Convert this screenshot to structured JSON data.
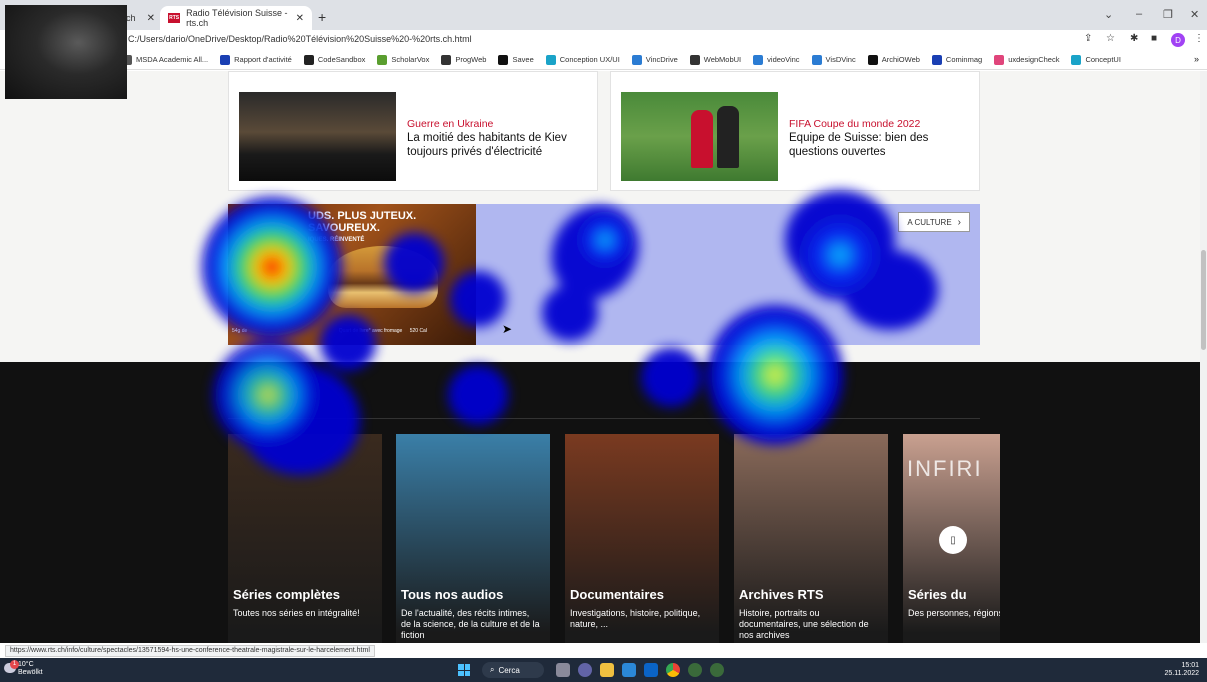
{
  "browser": {
    "tabs": [
      {
        "label": "ch",
        "active": false
      },
      {
        "label": "Radio Télévision Suisse - rts.ch",
        "active": true,
        "favicon": "RTS"
      }
    ],
    "new_tab_label": "+",
    "address": "C:/Users/dario/OneDrive/Desktop/Radio%20Télévision%20Suisse%20-%20rts.ch.html",
    "profile_initial": "D",
    "bookmarks": [
      {
        "label": "MSDA Academic All...",
        "icon": "bookmark-icon",
        "color": "#555555"
      },
      {
        "label": "Rapport d'activité",
        "icon": "k-icon",
        "color": "#1a3fb3"
      },
      {
        "label": "CodeSandbox",
        "icon": "box-icon",
        "color": "#222222"
      },
      {
        "label": "ScholarVox",
        "icon": "leaf-icon",
        "color": "#5a9e2f"
      },
      {
        "label": "ProgWeb",
        "icon": "grid-icon",
        "color": "#333333"
      },
      {
        "label": "Savee",
        "icon": "s-icon",
        "color": "#111111"
      },
      {
        "label": "Conception UX/UI",
        "icon": "m-icon",
        "color": "#1aa3c8"
      },
      {
        "label": "VincDrive",
        "icon": "ms-icon",
        "color": "#2b7cd3"
      },
      {
        "label": "WebMobUI",
        "icon": "grid-icon",
        "color": "#333333"
      },
      {
        "label": "videoVinc",
        "icon": "ms-icon",
        "color": "#2b7cd3"
      },
      {
        "label": "VisDVinc",
        "icon": "ms-icon",
        "color": "#2b7cd3"
      },
      {
        "label": "ArchiOWeb",
        "icon": "github-icon",
        "color": "#111111"
      },
      {
        "label": "Cominmag",
        "icon": "c-icon",
        "color": "#1a3fb3"
      },
      {
        "label": "uxdesignCheck",
        "icon": "v-icon",
        "color": "#e0457b"
      },
      {
        "label": "ConceptUI",
        "icon": "m-icon",
        "color": "#1aa3c8"
      }
    ],
    "more_bookmarks": "»",
    "status_url": "https://www.rts.ch/info/culture/spectacles/13571594-hs-une-conference-theatrale-magistrale-sur-le-harcelement.html"
  },
  "news_cards": [
    {
      "kicker": "Guerre en Ukraine",
      "title": "La moitié des habitants de Kiev toujours privés d'électricité"
    },
    {
      "kicker": "FIFA Coupe du monde 2022",
      "title": "Equipe de Suisse: bien des questions ouvertes"
    }
  ],
  "ad": {
    "headline_1": "UDS. PLUS JUTEUX.",
    "headline_2": "SAVOUREUX.",
    "headline_3": "IQUES. RÉINVENTÉ",
    "fineprint_1": "54g de",
    "fineprint_2": "Quart de livre* avec fromage",
    "fineprint_3": "520 Cal"
  },
  "culture_button": "A CULTURE",
  "tiles": [
    {
      "title": "Séries complètes",
      "desc": "Toutes nos séries en intégralité!",
      "bg": "#3a2a1e"
    },
    {
      "title": "Tous nos audios",
      "desc": "De l'actualité, des récits intimes, de la science, de la culture et de la fiction",
      "bg": "#3a7fa8"
    },
    {
      "title": "Documentaires",
      "desc": "Investigations, histoire, politique, nature, ...",
      "bg": "#7a3a20"
    },
    {
      "title": "Archives RTS",
      "desc": "Histoire, portraits ou documentaires, une sélection de nos archives",
      "bg": "#8a6a5a"
    },
    {
      "title": "Séries du",
      "desc": "Des personnes, régions dont on",
      "bg": "#c9a090",
      "overlay_text": "INFIRI"
    }
  ],
  "taskbar": {
    "weather_temp": "10°C",
    "weather_desc": "Bewölkt",
    "weather_badge": "1",
    "search_label": "Cerca",
    "time": "15:01",
    "date": "25.11.2022"
  }
}
